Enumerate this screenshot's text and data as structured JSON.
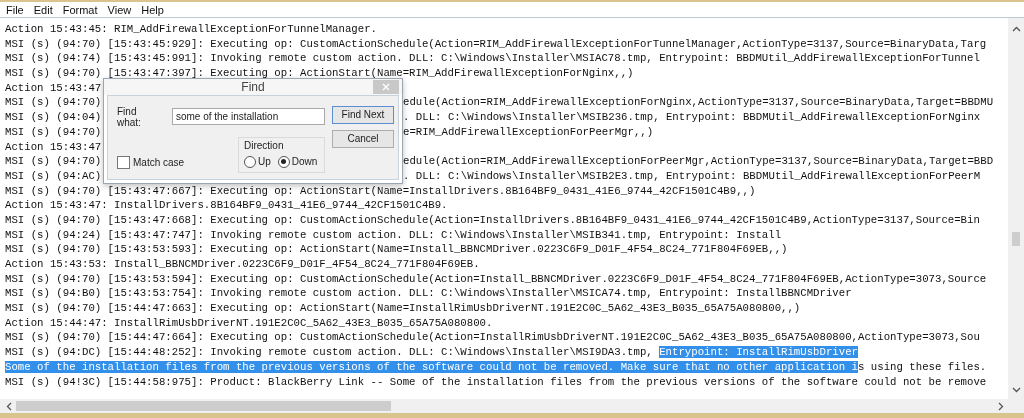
{
  "menu": [
    "File",
    "Edit",
    "Format",
    "View",
    "Help"
  ],
  "lines": [
    {
      "kind": "full",
      "segments": [
        {
          "text": "Action 15:43:45: RIM_AddFirewallExceptionForTunnelManager.",
          "selected": false
        }
      ]
    },
    {
      "kind": "full",
      "segments": [
        {
          "text": "MSI (s) (94:70) [15:43:45:929]: Executing op: CustomActionSchedule(Action=RIM_AddFirewallExceptionForTunnelManager,ActionType=3137,Source=BinaryData,Targ",
          "selected": false
        }
      ]
    },
    {
      "kind": "full",
      "segments": [
        {
          "text": "MSI (s) (94:74) [15:43:45:991]: Invoking remote custom action. DLL: C:\\Windows\\Installer\\MSIAC78.tmp, Entrypoint: BBDMUtil_AddFirewallExceptionForTunnel",
          "selected": false
        }
      ]
    },
    {
      "kind": "full",
      "segments": [
        {
          "text": "MSI (s) (94:70) [15:43:47:397]: Executing op: ActionStart(Name=RIM_AddFirewallExceptionForNginx,,)",
          "selected": false
        }
      ]
    },
    {
      "kind": "split",
      "left": "Action 15:43:47"
    },
    {
      "kind": "split",
      "left": "MSI (s) (94:70)",
      "right": "edule(Action=RIM_AddFirewallExceptionForNginx,ActionType=3137,Source=BinaryData,Target=BBDMU"
    },
    {
      "kind": "split",
      "left": "MSI (s) (94:04)",
      "right": ". DLL: C:\\Windows\\Installer\\MSIB236.tmp, Entrypoint: BBDMUtil_AddFirewallExceptionForNginx"
    },
    {
      "kind": "split",
      "left": "MSI (s) (94:70)",
      "right": "e=RIM_AddFirewallExceptionForPeerMgr,,)"
    },
    {
      "kind": "split",
      "left": "Action 15:43:47"
    },
    {
      "kind": "split",
      "left": "MSI (s) (94:70)",
      "right": "edule(Action=RIM_AddFirewallExceptionForPeerMgr,ActionType=3137,Source=BinaryData,Target=BBD"
    },
    {
      "kind": "split",
      "left": "MSI (s) (94:AC)",
      "right": ". DLL: C:\\Windows\\Installer\\MSIB2E3.tmp, Entrypoint: BBDMUtil_AddFirewallExceptionForPeerM"
    },
    {
      "kind": "full",
      "segments": [
        {
          "text": "MSI (s) (94:70) [15:43:47:667]: Executing op: ActionStart(Name=InstallDrivers.8B164BF9_0431_41E6_9744_42CF1501C4B9,,)",
          "selected": false
        }
      ]
    },
    {
      "kind": "full",
      "segments": [
        {
          "text": "Action 15:43:47: InstallDrivers.8B164BF9_0431_41E6_9744_42CF1501C4B9.",
          "selected": false
        }
      ]
    },
    {
      "kind": "full",
      "segments": [
        {
          "text": "MSI (s) (94:70) [15:43:47:668]: Executing op: CustomActionSchedule(Action=InstallDrivers.8B164BF9_0431_41E6_9744_42CF1501C4B9,ActionType=3137,Source=Bin",
          "selected": false
        }
      ]
    },
    {
      "kind": "full",
      "segments": [
        {
          "text": "MSI (s) (94:24) [15:43:47:747]: Invoking remote custom action. DLL: C:\\Windows\\Installer\\MSIB341.tmp, Entrypoint: Install",
          "selected": false
        }
      ]
    },
    {
      "kind": "full",
      "segments": [
        {
          "text": "MSI (s) (94:70) [15:43:53:593]: Executing op: ActionStart(Name=Install_BBNCMDriver.0223C6F9_D01F_4F54_8C24_771F804F69EB,,)",
          "selected": false
        }
      ]
    },
    {
      "kind": "full",
      "segments": [
        {
          "text": "Action 15:43:53: Install_BBNCMDriver.0223C6F9_D01F_4F54_8C24_771F804F69EB.",
          "selected": false
        }
      ]
    },
    {
      "kind": "full",
      "segments": [
        {
          "text": "MSI (s) (94:70) [15:43:53:594]: Executing op: CustomActionSchedule(Action=Install_BBNCMDriver.0223C6F9_D01F_4F54_8C24_771F804F69EB,ActionType=3073,Source",
          "selected": false
        }
      ]
    },
    {
      "kind": "full",
      "segments": [
        {
          "text": "MSI (s) (94:B0) [15:43:53:754]: Invoking remote custom action. DLL: C:\\Windows\\Installer\\MSICA74.tmp, Entrypoint: InstallBBNCMDriver",
          "selected": false
        }
      ]
    },
    {
      "kind": "full",
      "segments": [
        {
          "text": "MSI (s) (94:70) [15:44:47:663]: Executing op: ActionStart(Name=InstallRimUsbDriverNT.191E2C0C_5A62_43E3_B035_65A75A080800,,)",
          "selected": false
        }
      ]
    },
    {
      "kind": "full",
      "segments": [
        {
          "text": "Action 15:44:47: InstallRimUsbDriverNT.191E2C0C_5A62_43E3_B035_65A75A080800.",
          "selected": false
        }
      ]
    },
    {
      "kind": "full",
      "segments": [
        {
          "text": "MSI (s) (94:70) [15:44:47:664]: Executing op: CustomActionSchedule(Action=InstallRimUsbDriverNT.191E2C0C_5A62_43E3_B035_65A75A080800,ActionType=3073,Sou",
          "selected": false
        }
      ]
    },
    {
      "kind": "full",
      "segments": [
        {
          "text": "MSI (s) (94:DC) [15:44:48:252]: Invoking remote custom action. DLL: C:\\Windows\\Installer\\MSI9DA3.tmp, ",
          "selected": false
        },
        {
          "text": "Entrypoint: InstallRimUsbDriver",
          "selected": true
        }
      ]
    },
    {
      "kind": "full",
      "segments": [
        {
          "text": "Some of the installation files from the previous versions of the software could not be removed. Make sure that no other application i",
          "selected": true
        },
        {
          "text": "s using these files.",
          "selected": false
        }
      ]
    },
    {
      "kind": "full",
      "segments": [
        {
          "text": "MSI (s) (94!3C) [15:44:58:975]: Product: BlackBerry Link -- Some of the installation files from the previous versions of the software could not be remove",
          "selected": false
        }
      ]
    }
  ],
  "find_dialog": {
    "title": "Find",
    "find_what_label": "Find what:",
    "find_what_value": "some of the installation",
    "find_next": "Find Next",
    "cancel": "Cancel",
    "direction_label": "Direction",
    "directions": [
      {
        "label": "Up",
        "selected": false
      },
      {
        "label": "Down",
        "selected": true
      }
    ],
    "match_case": {
      "label": "Match case",
      "checked": false
    }
  }
}
